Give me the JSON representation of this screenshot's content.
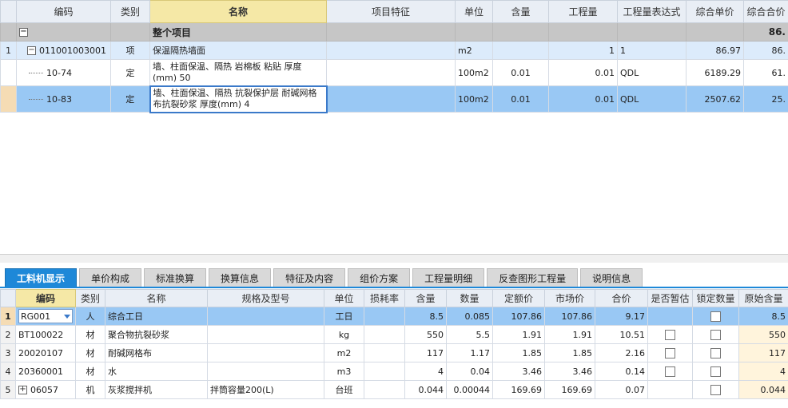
{
  "upper": {
    "columns": [
      "编码",
      "类别",
      "名称",
      "项目特征",
      "单位",
      "含量",
      "工程量",
      "工程量表达式",
      "综合单价",
      "综合合价"
    ],
    "total_row": {
      "toggle": "−",
      "label": "整个项目",
      "total": "86."
    },
    "item_row": {
      "rn": "1",
      "toggle": "−",
      "code": "011001003001",
      "type": "项",
      "name": "保温隔热墙面",
      "unit": "m2",
      "qty": "1",
      "expr": "1",
      "price": "86.97",
      "total": "86."
    },
    "rows": [
      {
        "code": "10-74",
        "type": "定",
        "name": "墙、柱面保温、隔热 岩棉板 粘贴 厚度(mm) 50",
        "unit": "100m2",
        "content": "0.01",
        "qty": "0.01",
        "expr": "QDL",
        "price": "6189.29",
        "total": "61."
      },
      {
        "code": "10-83",
        "type": "定",
        "name": "墙、柱面保温、隔热 抗裂保护层 耐碱网格布抗裂砂浆 厚度(mm) 4",
        "unit": "100m2",
        "content": "0.01",
        "qty": "0.01",
        "expr": "QDL",
        "price": "2507.62",
        "total": "25."
      }
    ]
  },
  "tabs": [
    "工料机显示",
    "单价构成",
    "标准换算",
    "换算信息",
    "特征及内容",
    "组价方案",
    "工程量明细",
    "反查图形工程量",
    "说明信息"
  ],
  "lower": {
    "columns": [
      "编码",
      "类别",
      "名称",
      "规格及型号",
      "单位",
      "损耗率",
      "含量",
      "数量",
      "定额价",
      "市场价",
      "合价",
      "是否暂估",
      "锁定数量",
      "原始含量"
    ],
    "rows": [
      {
        "rn": "1",
        "code": "RG001",
        "type": "人",
        "name": "综合工日",
        "spec": "",
        "unit": "工日",
        "loss": "",
        "content": "8.5",
        "amount": "0.085",
        "quota": "107.86",
        "market": "107.86",
        "total": "9.17",
        "orig": "8.5"
      },
      {
        "rn": "2",
        "code": "BT100022",
        "type": "材",
        "name": "聚合物抗裂砂浆",
        "spec": "",
        "unit": "kg",
        "loss": "",
        "content": "550",
        "amount": "5.5",
        "quota": "1.91",
        "market": "1.91",
        "total": "10.51",
        "orig": "550"
      },
      {
        "rn": "3",
        "code": "20020107",
        "type": "材",
        "name": "耐碱网格布",
        "spec": "",
        "unit": "m2",
        "loss": "",
        "content": "117",
        "amount": "1.17",
        "quota": "1.85",
        "market": "1.85",
        "total": "2.16",
        "orig": "117"
      },
      {
        "rn": "4",
        "code": "20360001",
        "type": "材",
        "name": "水",
        "spec": "",
        "unit": "m3",
        "loss": "",
        "content": "4",
        "amount": "0.04",
        "quota": "3.46",
        "market": "3.46",
        "total": "0.14",
        "orig": "4"
      },
      {
        "rn": "5",
        "code": "06057",
        "type": "机",
        "name": "灰浆搅拌机",
        "spec": "拌筒容量200(L)",
        "unit": "台班",
        "loss": "",
        "content": "0.044",
        "amount": "0.00044",
        "quota": "169.69",
        "market": "169.69",
        "total": "0.07",
        "orig": "0.044"
      }
    ],
    "row5_toggle": "+"
  }
}
